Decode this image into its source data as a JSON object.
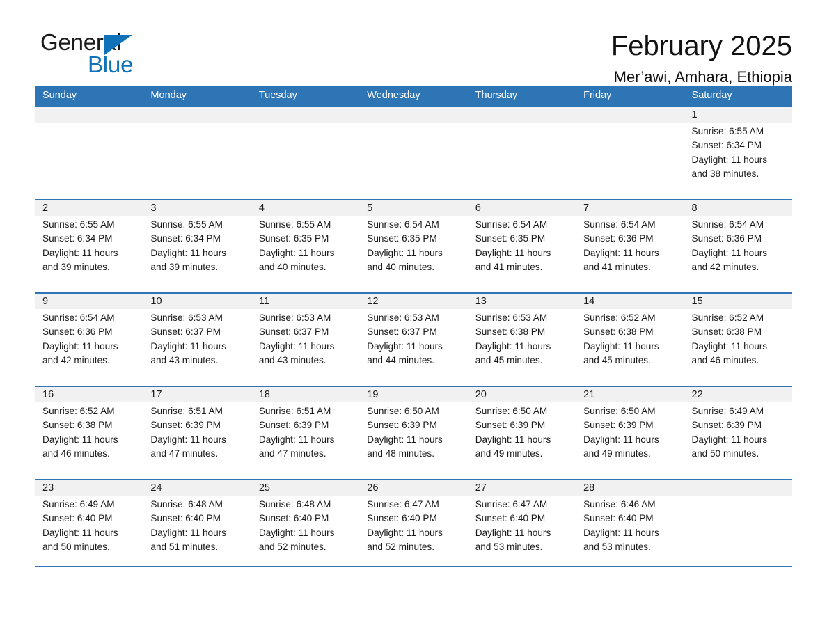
{
  "brand": {
    "name_part1": "General",
    "name_part2": "Blue",
    "accent_color": "#1072b8"
  },
  "header": {
    "month_title": "February 2025",
    "location": "Mer’awi, Amhara, Ethiopia"
  },
  "theme": {
    "header_blue": "#2e75b6",
    "daynum_bg": "#f1f1f1",
    "text": "#1a1a1a"
  },
  "weekdays": [
    "Sunday",
    "Monday",
    "Tuesday",
    "Wednesday",
    "Thursday",
    "Friday",
    "Saturday"
  ],
  "weeks": [
    [
      {
        "day": "",
        "sunrise": "",
        "sunset": "",
        "daylight1": "",
        "daylight2": ""
      },
      {
        "day": "",
        "sunrise": "",
        "sunset": "",
        "daylight1": "",
        "daylight2": ""
      },
      {
        "day": "",
        "sunrise": "",
        "sunset": "",
        "daylight1": "",
        "daylight2": ""
      },
      {
        "day": "",
        "sunrise": "",
        "sunset": "",
        "daylight1": "",
        "daylight2": ""
      },
      {
        "day": "",
        "sunrise": "",
        "sunset": "",
        "daylight1": "",
        "daylight2": ""
      },
      {
        "day": "",
        "sunrise": "",
        "sunset": "",
        "daylight1": "",
        "daylight2": ""
      },
      {
        "day": "1",
        "sunrise": "Sunrise: 6:55 AM",
        "sunset": "Sunset: 6:34 PM",
        "daylight1": "Daylight: 11 hours",
        "daylight2": "and 38 minutes."
      }
    ],
    [
      {
        "day": "2",
        "sunrise": "Sunrise: 6:55 AM",
        "sunset": "Sunset: 6:34 PM",
        "daylight1": "Daylight: 11 hours",
        "daylight2": "and 39 minutes."
      },
      {
        "day": "3",
        "sunrise": "Sunrise: 6:55 AM",
        "sunset": "Sunset: 6:34 PM",
        "daylight1": "Daylight: 11 hours",
        "daylight2": "and 39 minutes."
      },
      {
        "day": "4",
        "sunrise": "Sunrise: 6:55 AM",
        "sunset": "Sunset: 6:35 PM",
        "daylight1": "Daylight: 11 hours",
        "daylight2": "and 40 minutes."
      },
      {
        "day": "5",
        "sunrise": "Sunrise: 6:54 AM",
        "sunset": "Sunset: 6:35 PM",
        "daylight1": "Daylight: 11 hours",
        "daylight2": "and 40 minutes."
      },
      {
        "day": "6",
        "sunrise": "Sunrise: 6:54 AM",
        "sunset": "Sunset: 6:35 PM",
        "daylight1": "Daylight: 11 hours",
        "daylight2": "and 41 minutes."
      },
      {
        "day": "7",
        "sunrise": "Sunrise: 6:54 AM",
        "sunset": "Sunset: 6:36 PM",
        "daylight1": "Daylight: 11 hours",
        "daylight2": "and 41 minutes."
      },
      {
        "day": "8",
        "sunrise": "Sunrise: 6:54 AM",
        "sunset": "Sunset: 6:36 PM",
        "daylight1": "Daylight: 11 hours",
        "daylight2": "and 42 minutes."
      }
    ],
    [
      {
        "day": "9",
        "sunrise": "Sunrise: 6:54 AM",
        "sunset": "Sunset: 6:36 PM",
        "daylight1": "Daylight: 11 hours",
        "daylight2": "and 42 minutes."
      },
      {
        "day": "10",
        "sunrise": "Sunrise: 6:53 AM",
        "sunset": "Sunset: 6:37 PM",
        "daylight1": "Daylight: 11 hours",
        "daylight2": "and 43 minutes."
      },
      {
        "day": "11",
        "sunrise": "Sunrise: 6:53 AM",
        "sunset": "Sunset: 6:37 PM",
        "daylight1": "Daylight: 11 hours",
        "daylight2": "and 43 minutes."
      },
      {
        "day": "12",
        "sunrise": "Sunrise: 6:53 AM",
        "sunset": "Sunset: 6:37 PM",
        "daylight1": "Daylight: 11 hours",
        "daylight2": "and 44 minutes."
      },
      {
        "day": "13",
        "sunrise": "Sunrise: 6:53 AM",
        "sunset": "Sunset: 6:38 PM",
        "daylight1": "Daylight: 11 hours",
        "daylight2": "and 45 minutes."
      },
      {
        "day": "14",
        "sunrise": "Sunrise: 6:52 AM",
        "sunset": "Sunset: 6:38 PM",
        "daylight1": "Daylight: 11 hours",
        "daylight2": "and 45 minutes."
      },
      {
        "day": "15",
        "sunrise": "Sunrise: 6:52 AM",
        "sunset": "Sunset: 6:38 PM",
        "daylight1": "Daylight: 11 hours",
        "daylight2": "and 46 minutes."
      }
    ],
    [
      {
        "day": "16",
        "sunrise": "Sunrise: 6:52 AM",
        "sunset": "Sunset: 6:38 PM",
        "daylight1": "Daylight: 11 hours",
        "daylight2": "and 46 minutes."
      },
      {
        "day": "17",
        "sunrise": "Sunrise: 6:51 AM",
        "sunset": "Sunset: 6:39 PM",
        "daylight1": "Daylight: 11 hours",
        "daylight2": "and 47 minutes."
      },
      {
        "day": "18",
        "sunrise": "Sunrise: 6:51 AM",
        "sunset": "Sunset: 6:39 PM",
        "daylight1": "Daylight: 11 hours",
        "daylight2": "and 47 minutes."
      },
      {
        "day": "19",
        "sunrise": "Sunrise: 6:50 AM",
        "sunset": "Sunset: 6:39 PM",
        "daylight1": "Daylight: 11 hours",
        "daylight2": "and 48 minutes."
      },
      {
        "day": "20",
        "sunrise": "Sunrise: 6:50 AM",
        "sunset": "Sunset: 6:39 PM",
        "daylight1": "Daylight: 11 hours",
        "daylight2": "and 49 minutes."
      },
      {
        "day": "21",
        "sunrise": "Sunrise: 6:50 AM",
        "sunset": "Sunset: 6:39 PM",
        "daylight1": "Daylight: 11 hours",
        "daylight2": "and 49 minutes."
      },
      {
        "day": "22",
        "sunrise": "Sunrise: 6:49 AM",
        "sunset": "Sunset: 6:39 PM",
        "daylight1": "Daylight: 11 hours",
        "daylight2": "and 50 minutes."
      }
    ],
    [
      {
        "day": "23",
        "sunrise": "Sunrise: 6:49 AM",
        "sunset": "Sunset: 6:40 PM",
        "daylight1": "Daylight: 11 hours",
        "daylight2": "and 50 minutes."
      },
      {
        "day": "24",
        "sunrise": "Sunrise: 6:48 AM",
        "sunset": "Sunset: 6:40 PM",
        "daylight1": "Daylight: 11 hours",
        "daylight2": "and 51 minutes."
      },
      {
        "day": "25",
        "sunrise": "Sunrise: 6:48 AM",
        "sunset": "Sunset: 6:40 PM",
        "daylight1": "Daylight: 11 hours",
        "daylight2": "and 52 minutes."
      },
      {
        "day": "26",
        "sunrise": "Sunrise: 6:47 AM",
        "sunset": "Sunset: 6:40 PM",
        "daylight1": "Daylight: 11 hours",
        "daylight2": "and 52 minutes."
      },
      {
        "day": "27",
        "sunrise": "Sunrise: 6:47 AM",
        "sunset": "Sunset: 6:40 PM",
        "daylight1": "Daylight: 11 hours",
        "daylight2": "and 53 minutes."
      },
      {
        "day": "28",
        "sunrise": "Sunrise: 6:46 AM",
        "sunset": "Sunset: 6:40 PM",
        "daylight1": "Daylight: 11 hours",
        "daylight2": "and 53 minutes."
      },
      {
        "day": "",
        "sunrise": "",
        "sunset": "",
        "daylight1": "",
        "daylight2": ""
      }
    ]
  ]
}
